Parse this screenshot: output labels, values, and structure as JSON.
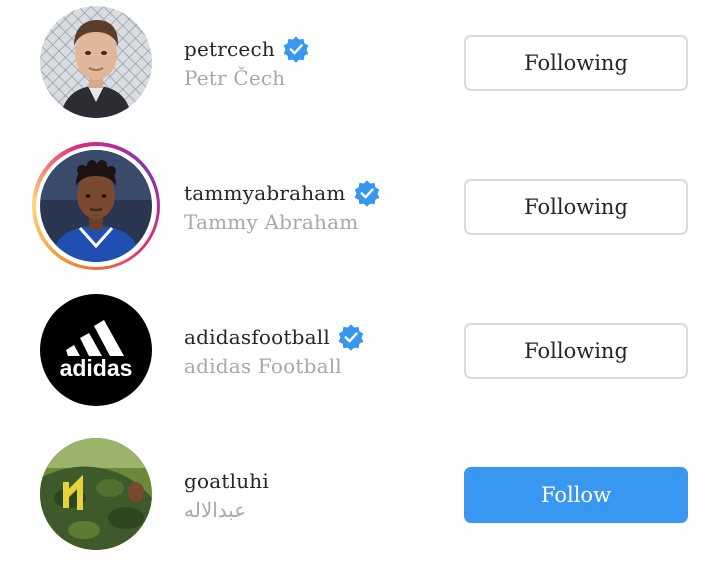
{
  "accounts": [
    {
      "username": "petrcech",
      "full_name": "Petr Čech",
      "verified": true,
      "has_story": false,
      "button_label": "Following",
      "following": true
    },
    {
      "username": "tammyabraham",
      "full_name": "Tammy Abraham",
      "verified": true,
      "has_story": true,
      "button_label": "Following",
      "following": true
    },
    {
      "username": "adidasfootball",
      "full_name": "adidas Football",
      "verified": true,
      "has_story": false,
      "button_label": "Following",
      "following": true,
      "avatar_logo_text": "adidas"
    },
    {
      "username": "goatluhi",
      "full_name": "عبدالاله",
      "verified": false,
      "has_story": false,
      "button_label": "Follow",
      "following": false
    }
  ],
  "colors": {
    "verified_badge": "#3897f0",
    "follow_button": "#3897f0",
    "following_border": "#dbdbdb",
    "secondary_text": "#a8a8a8"
  }
}
